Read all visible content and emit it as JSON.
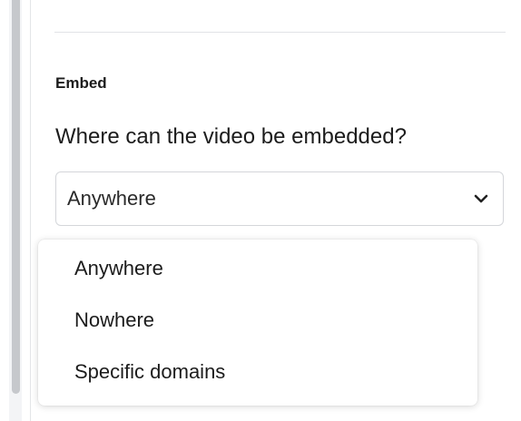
{
  "embed": {
    "heading": "Embed",
    "question": "Where can the video be embedded?",
    "select": {
      "value": "Anywhere",
      "icon": "chevron-down-icon"
    },
    "options": [
      {
        "label": "Anywhere"
      },
      {
        "label": "Nowhere"
      },
      {
        "label": "Specific domains"
      }
    ]
  },
  "colors": {
    "text": "#1c1c1c",
    "border": "#d4d6da",
    "scrollbar_thumb": "#c6c8cc"
  }
}
